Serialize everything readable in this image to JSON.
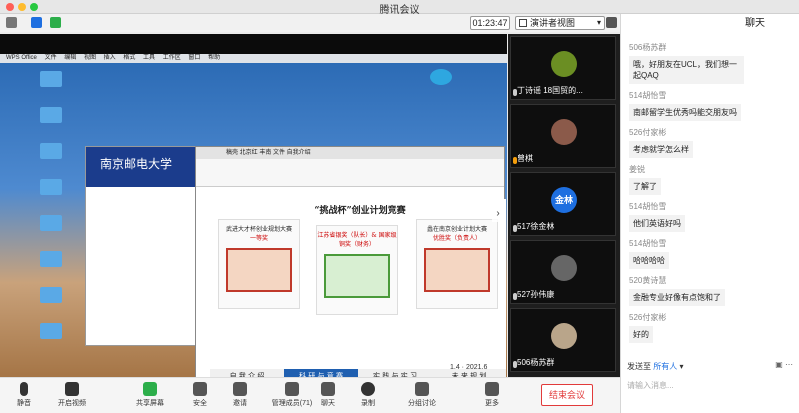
{
  "window": {
    "title": "腾讯会议"
  },
  "toolbar": {
    "timer": "01:23:47",
    "view_label": "演讲者视图"
  },
  "share": {
    "menubar": [
      "WPS Office",
      "文件",
      "编辑",
      "视图",
      "插入",
      "格式",
      "工具",
      "工作区",
      "窗口",
      "帮助"
    ],
    "back_window_title": "南京邮电大学",
    "front_window": {
      "tabs": "稿壳 北京红 丰南 文件 自我介绍",
      "slide_title": "“挑战杯”创业计划竞赛",
      "awards": [
        {
          "title": "武进大才杯创业规划大赛",
          "sub": "一等奖"
        },
        {
          "title": "江苏省银奖（队长）& 国家级铜奖（财务）",
          "sub": ""
        },
        {
          "title": "蠡在南京创业计划大赛",
          "sub": "优胜奖（负责人）"
        }
      ],
      "nav": [
        "自 我 介 绍",
        "科 研 与 竞 赛",
        "实 践 与 实 习",
        "未 来 规 划"
      ]
    },
    "page_num": "1.4 · 2021.6"
  },
  "participants": [
    {
      "name": "丁诗谣 18国贸的..."
    },
    {
      "name": "曾棋"
    },
    {
      "name": "517徐金林",
      "avatar_text": "金林"
    },
    {
      "name": "527孙伟康"
    },
    {
      "name": "506杨苏群"
    }
  ],
  "chat": {
    "title": "聊天",
    "messages": [
      {
        "sender": "506杨苏群",
        "text": "哦，好朋友在UCL，我们想一起QAQ"
      },
      {
        "sender": "514胡怡雪",
        "text": "南邮留学生优秀吗能交朋友吗"
      },
      {
        "sender": "526付家彬",
        "text": "考虑就学怎么样"
      },
      {
        "sender": "姜锐",
        "text": "了解了"
      },
      {
        "sender": "514胡怡雪",
        "text": "他们英语好吗"
      },
      {
        "sender": "514胡怡雪",
        "text": "哈哈哈哈"
      },
      {
        "sender": "520黄诗慧",
        "text": "金融专业好像有点饱和了"
      },
      {
        "sender": "526付家彬",
        "text": "好的"
      }
    ],
    "send_to_label": "发送至",
    "send_to_target": "所有人",
    "input_placeholder": "请输入消息..."
  },
  "controls": {
    "items": [
      "静音",
      "开启视频",
      "共享屏幕",
      "安全",
      "邀请",
      "管理成员(71)",
      "聊天",
      "录制",
      "分组讨论",
      "更多"
    ],
    "end_label": "结束会议"
  },
  "colors": {
    "accent": "#1e6fe0",
    "danger": "#e23b3b",
    "share_bg": "#1f6fb3"
  }
}
